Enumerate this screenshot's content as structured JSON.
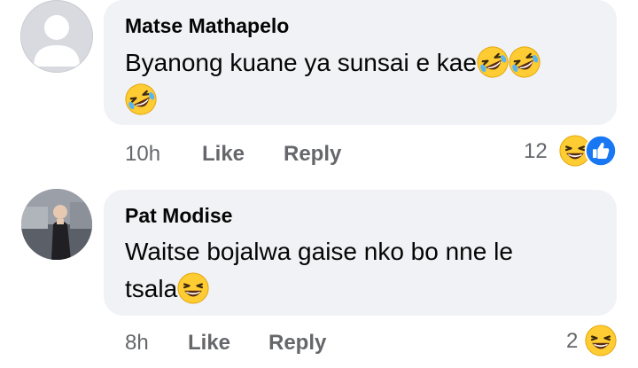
{
  "comments": [
    {
      "author": "Matse Mathapelo",
      "text_line1": "Byanong kuane ya sunsai e kae",
      "time": "10h",
      "like_label": "Like",
      "reply_label": "Reply",
      "reaction_count": "12",
      "reaction_icons": [
        "laughing-face-icon",
        "thumbs-up-icon"
      ]
    },
    {
      "author": "Pat Modise",
      "text_line1": "Waitse bojalwa gaise nko bo nne le",
      "text_line2": "tsala",
      "time": "8h",
      "like_label": "Like",
      "reply_label": "Reply",
      "reaction_count": "2",
      "reaction_icons": [
        "laughing-face-icon"
      ]
    }
  ],
  "colors": {
    "bubble": "#f0f2f5",
    "meta_text": "#65676b",
    "like_blue": "#1877f2",
    "emoji_yellow": "#ffcc33"
  }
}
